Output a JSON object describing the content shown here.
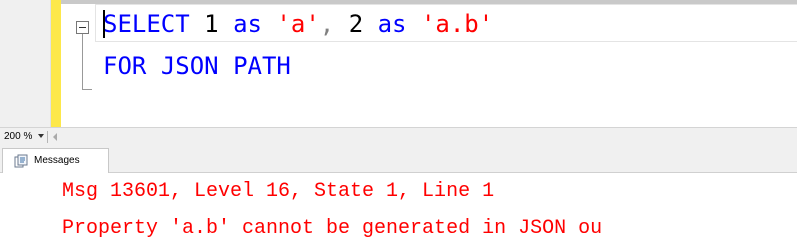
{
  "editor": {
    "line1": {
      "select_kw": "SELECT",
      "num1": "1",
      "as1": "as",
      "alias1": "'a'",
      "comma": ",",
      "num2": "2",
      "as2": "as",
      "alias2": "'a.b'"
    },
    "line2": {
      "for_kw": "FOR",
      "json_kw": "JSON",
      "path_kw": "PATH"
    },
    "fold_icon": "collapse-minus-icon"
  },
  "zoom": {
    "label": "200 %"
  },
  "results_tabs": [
    {
      "label": "Messages",
      "icon": "messages-icon"
    }
  ],
  "messages": {
    "lines": [
      "Msg 13601, Level 16, State 1, Line 1",
      "Property 'a.b' cannot be generated in JSON ou"
    ]
  },
  "colors": {
    "keyword": "#0000ff",
    "string": "#ff0000",
    "error_text": "#ff0000",
    "change_bar": "#fde84a"
  }
}
